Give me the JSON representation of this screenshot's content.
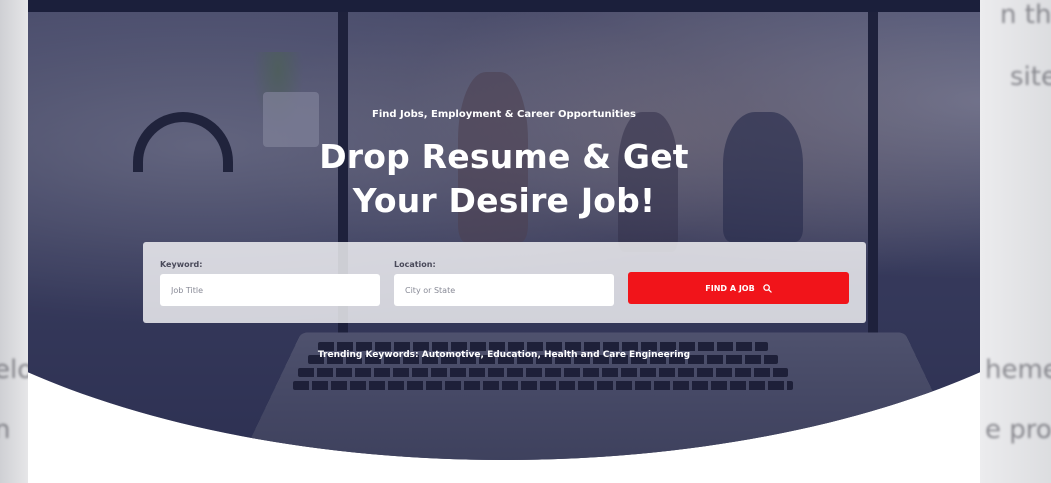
{
  "hero": {
    "subtitle": "Find Jobs, Employment & Career Opportunities",
    "title_line1": "Drop Resume & Get",
    "title_line2": "Your Desire Job!"
  },
  "search": {
    "keyword_label": "Keyword:",
    "keyword_placeholder": "Job Title",
    "location_label": "Location:",
    "location_placeholder": "City or State",
    "button_label": "FIND A JOB",
    "button_icon": "search-icon"
  },
  "trending": {
    "text": "Trending Keywords: Automotive, Education, Health and Care Engineering"
  },
  "colors": {
    "accent": "#f1141a",
    "topbar": "#1b1f3b",
    "overlay": "#23264e"
  }
}
